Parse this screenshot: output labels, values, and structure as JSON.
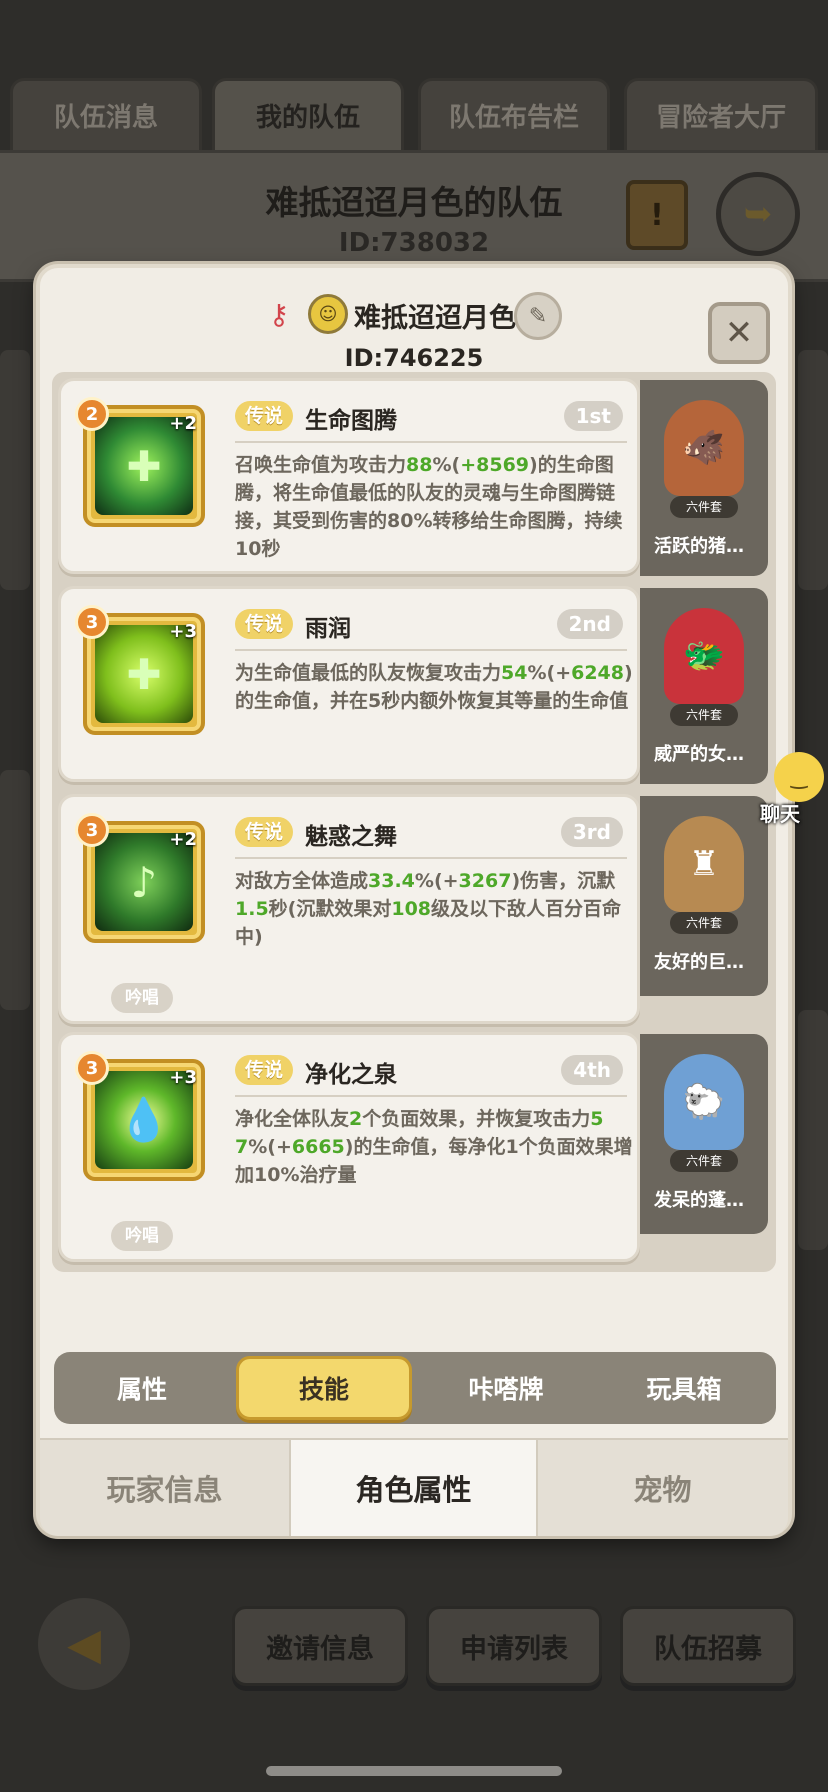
{
  "background": {
    "top_tabs": [
      "队伍消息",
      "我的队伍",
      "队伍布告栏",
      "冒险者大厅"
    ],
    "active_top_tab": 1,
    "team_name": "难抵迢迢月色的队伍",
    "team_id": "ID:738032",
    "bottom_buttons": [
      "邀请信息",
      "申请列表",
      "队伍招募"
    ]
  },
  "modal": {
    "player_name": "难抵迢迢月色",
    "player_id": "ID:746225",
    "close_icon": "close-icon",
    "skills": [
      {
        "level": "2",
        "plus": "+2",
        "rarity": "传说",
        "name": "生命图腾",
        "rank": "1st",
        "desc_parts": [
          "召唤生命值为攻击力",
          "88",
          "%(",
          "+8569",
          ")的生命图腾，将生命值最低的队友的灵魂与生命图腾链接，其受到伤害的80%转移给生命图腾，持续10秒"
        ],
        "chant": ""
      },
      {
        "level": "3",
        "plus": "+3",
        "rarity": "传说",
        "name": "雨润",
        "rank": "2nd",
        "desc_parts": [
          "为生命值最低的队友恢复攻击力",
          "54",
          "%(+",
          "6248",
          ")的生命值，并在5秒内额外恢复其等量的生命值"
        ],
        "chant": ""
      },
      {
        "level": "3",
        "plus": "+2",
        "rarity": "传说",
        "name": "魅惑之舞",
        "rank": "3rd",
        "desc_parts": [
          "对敌方全体造成",
          "33.4",
          "%(+",
          "3267",
          ")伤害，沉默",
          "1.5",
          "秒(沉默效果对",
          "108",
          "级及以下敌人百分百命中)"
        ],
        "chant": "吟唱"
      },
      {
        "level": "3",
        "plus": "+3",
        "rarity": "传说",
        "name": "净化之泉",
        "rank": "4th",
        "desc_parts": [
          "净化全体队友",
          "2",
          "个负面效果，并恢复攻击力",
          "57",
          "%(+",
          "6665",
          ")的生命值，每净化1个负面效果增加10%治疗量"
        ],
        "chant": "吟唱"
      }
    ],
    "pets": [
      {
        "name": "活跃的猪…",
        "set_tag": "六件套",
        "color": "#b5653a"
      },
      {
        "name": "威严的女…",
        "set_tag": "六件套",
        "color": "#c9333b"
      },
      {
        "name": "友好的巨…",
        "set_tag": "六件套",
        "color": "#b78a52"
      },
      {
        "name": "发呆的蓬…",
        "set_tag": "六件套",
        "color": "#6fa0d4"
      }
    ],
    "sub_tabs": [
      "属性",
      "技能",
      "咔嗒牌",
      "玩具箱"
    ],
    "active_sub_tab": 1,
    "main_tabs": [
      "玩家信息",
      "角色属性",
      "宠物"
    ],
    "active_main_tab": 1
  },
  "chat": {
    "label": "聊天"
  },
  "colors": {
    "accent_gold": "#f3d86d",
    "highlight_green": "#4ea829",
    "rarity_gold": "#f0d267"
  }
}
